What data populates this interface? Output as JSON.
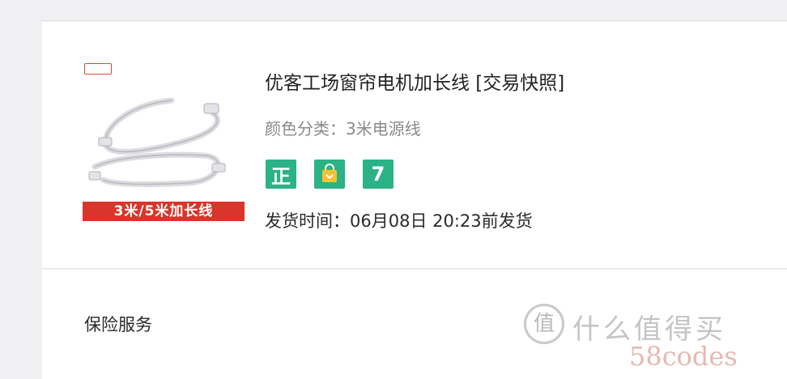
{
  "product": {
    "thumbnail": {
      "logo_text": "",
      "subtitle_text": "",
      "banner_text": "3米/5米加长线"
    },
    "title": "优客工场窗帘电机加长线 [交易快照]",
    "variant": "颜色分类：3米电源线",
    "badges": [
      {
        "icon": "genuine-icon",
        "label": "正"
      },
      {
        "icon": "shopping-bag-icon",
        "label": ""
      },
      {
        "icon": "seven-day-return-icon",
        "label": "7"
      }
    ],
    "badge_color": "#2bb286",
    "shipping": "发货时间：06月08日 20:23前发货"
  },
  "insurance": {
    "label": "保险服务"
  },
  "watermark": {
    "circle_char": "值",
    "text": "什么值得买",
    "site": "58codes"
  }
}
